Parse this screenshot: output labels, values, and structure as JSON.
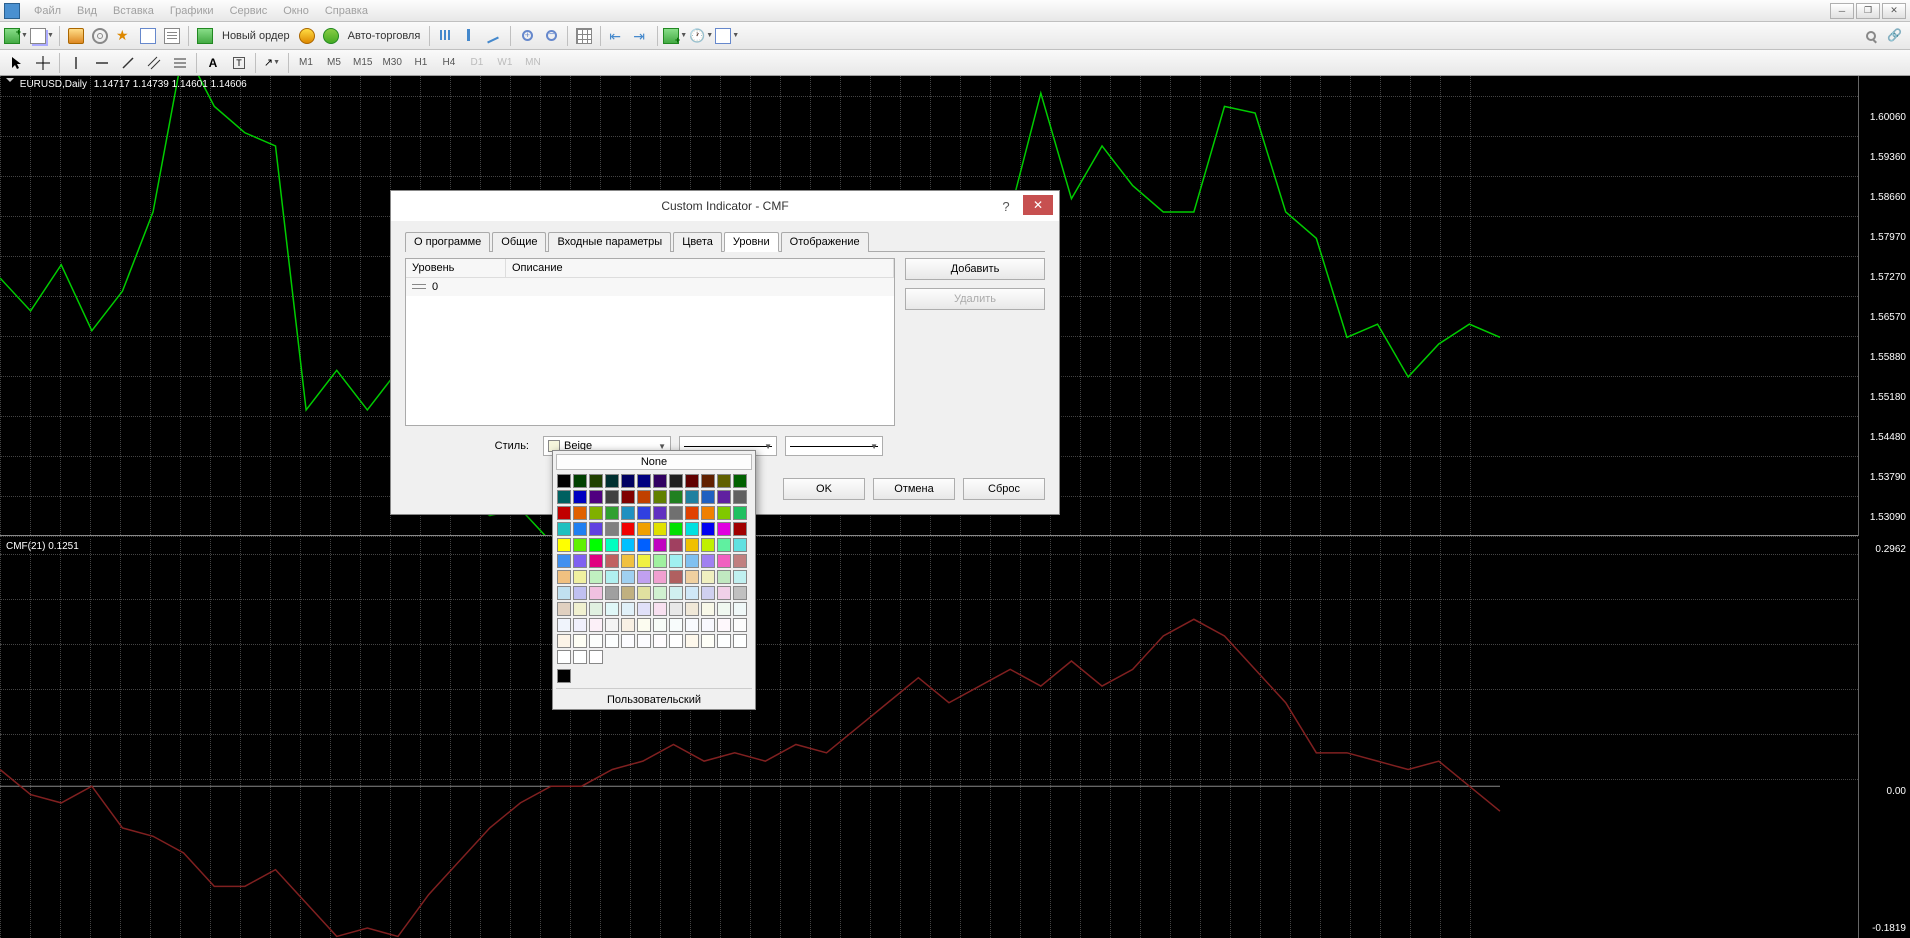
{
  "menu": {
    "items": [
      "Файл",
      "Вид",
      "Вставка",
      "Графики",
      "Сервис",
      "Окно",
      "Справка"
    ]
  },
  "toolbar1": {
    "new_order": "Новый ордер",
    "auto_trade": "Авто-торговля"
  },
  "timeframes": [
    "M1",
    "M5",
    "M15",
    "M30",
    "H1",
    "H4",
    "D1",
    "W1",
    "MN"
  ],
  "active_tf": "D1",
  "mainChart": {
    "label": "EURUSD,Daily",
    "ohlc": "1.14717 1.14739 1.14601 1.14606",
    "yticks": [
      "1.60060",
      "1.59360",
      "1.58660",
      "1.57970",
      "1.57270",
      "1.56570",
      "1.55880",
      "1.55180",
      "1.54480",
      "1.53790",
      "1.53090"
    ]
  },
  "subChart": {
    "label": "CMF(21) 0.1251",
    "yticks": [
      "0.2962",
      "0.00",
      "-0.1819"
    ]
  },
  "dialog": {
    "title": "Custom Indicator - CMF",
    "tabs": [
      "О программе",
      "Общие",
      "Входные параметры",
      "Цвета",
      "Уровни",
      "Отображение"
    ],
    "active_tab": "Уровни",
    "cols": {
      "level": "Уровень",
      "desc": "Описание"
    },
    "row_value": "0",
    "add": "Добавить",
    "del": "Удалить",
    "style_label": "Стиль:",
    "color_name": "Beige",
    "ok": "OK",
    "cancel": "Отмена",
    "reset": "Сброс"
  },
  "picker": {
    "none": "None",
    "custom": "Пользовательский",
    "colors": [
      "#000000",
      "#004000",
      "#204000",
      "#003030",
      "#000060",
      "#000080",
      "#300060",
      "#202020",
      "#600000",
      "#602000",
      "#606000",
      "#006000",
      "#006060",
      "#0000c0",
      "#500080",
      "#404040",
      "#800000",
      "#c04000",
      "#608000",
      "#208020",
      "#2080a0",
      "#2060c0",
      "#6020a0",
      "#606060",
      "#c00000",
      "#e06000",
      "#80b000",
      "#30a030",
      "#2090c0",
      "#3040e0",
      "#6030c0",
      "#707070",
      "#e04000",
      "#f08000",
      "#80c800",
      "#20c060",
      "#20c0c0",
      "#2080f0",
      "#6040e0",
      "#808080",
      "#f00000",
      "#f0a000",
      "#e0e000",
      "#00e000",
      "#00e0e0",
      "#0000f0",
      "#e000e0",
      "#a00000",
      "#ffff00",
      "#60f000",
      "#00ff00",
      "#00ffc0",
      "#00c0ff",
      "#0060ff",
      "#c000c0",
      "#a04060",
      "#f0c000",
      "#c0f000",
      "#60f0a0",
      "#60e0e0",
      "#4090f0",
      "#8060f0",
      "#e00080",
      "#c06060",
      "#f0c040",
      "#f0f040",
      "#a0f0a0",
      "#a0f0f0",
      "#80c0f0",
      "#a080f0",
      "#f060c0",
      "#c08080",
      "#f0c080",
      "#f0f0a0",
      "#c0f0c0",
      "#b0f0f0",
      "#a0d0f0",
      "#c0a0f0",
      "#f0a0d0",
      "#b06060",
      "#f0d0a0",
      "#f0f0c0",
      "#c0e8c0",
      "#c0f0f0",
      "#c0e0f0",
      "#c0c0f0",
      "#f0c0e0",
      "#a0a0a0",
      "#c0b080",
      "#e0e0a0",
      "#d0f0d0",
      "#d0f0f0",
      "#d0e8f8",
      "#d0d0f0",
      "#f0d0e8",
      "#c0c0c0",
      "#e0d0c0",
      "#f0f0d0",
      "#e0f0e0",
      "#e0f8f8",
      "#e0f0f8",
      "#e0e0f8",
      "#f8e0f0",
      "#e8e8e8",
      "#f0e8d8",
      "#f8f8e8",
      "#f0f8f0",
      "#f0f8f8",
      "#f0f4fc",
      "#f0f0fc",
      "#fcf0f8",
      "#f4f4f4",
      "#f8f0e4",
      "#fcfcf0",
      "#f8fcf8",
      "#f8fcfc",
      "#f8fafe",
      "#f8f8fe",
      "#fef8fc",
      "#fcfcfc",
      "#fcf4e8",
      "#fefef4",
      "#fcfefc",
      "#fcfefe",
      "#fcfcff",
      "#fcfcff",
      "#fffcfe",
      "#ffffff",
      "#fef8ec",
      "#fffff8",
      "#feffff",
      "#feffff",
      "#feffff",
      "#feffff",
      "#fffeff"
    ],
    "extra": "#000000"
  },
  "chart_data": {
    "type": "line",
    "main": {
      "series_name": "EURUSD",
      "x": [
        0,
        1,
        2,
        3,
        4,
        5,
        6,
        7,
        8,
        9,
        10,
        11,
        12,
        13,
        14,
        15,
        16,
        17,
        18,
        19,
        20,
        21,
        22,
        23,
        24,
        25,
        26,
        27,
        28,
        29,
        30,
        31,
        32,
        33,
        34,
        35,
        36,
        37,
        38,
        39,
        40,
        41,
        42,
        43,
        44,
        45,
        46,
        47,
        48,
        49
      ],
      "y": [
        1.57,
        1.565,
        1.572,
        1.562,
        1.568,
        1.58,
        1.605,
        1.596,
        1.592,
        1.59,
        1.55,
        1.556,
        1.55,
        1.556,
        1.54,
        1.537,
        1.534,
        1.535,
        1.53,
        1.54,
        1.56,
        1.554,
        1.548,
        1.548,
        1.552,
        1.565,
        1.565,
        1.565,
        1.564,
        1.566,
        1.557,
        1.568,
        1.568,
        1.58,
        1.598,
        1.582,
        1.59,
        1.584,
        1.58,
        1.58,
        1.596,
        1.595,
        1.58,
        1.576,
        1.561,
        1.563,
        1.555,
        1.56,
        1.563,
        1.561
      ],
      "ylim": [
        1.5309,
        1.6006
      ],
      "color": "#00cc00"
    },
    "sub": {
      "series_name": "CMF(21)",
      "x": [
        0,
        1,
        2,
        3,
        4,
        5,
        6,
        7,
        8,
        9,
        10,
        11,
        12,
        13,
        14,
        15,
        16,
        17,
        18,
        19,
        20,
        21,
        22,
        23,
        24,
        25,
        26,
        27,
        28,
        29,
        30,
        31,
        32,
        33,
        34,
        35,
        36,
        37,
        38,
        39,
        40,
        41,
        42,
        43,
        44,
        45,
        46,
        47,
        48,
        49
      ],
      "y": [
        0.02,
        -0.01,
        -0.02,
        0.0,
        -0.05,
        -0.06,
        -0.08,
        -0.12,
        -0.12,
        -0.1,
        -0.14,
        -0.18,
        -0.17,
        -0.18,
        -0.13,
        -0.09,
        -0.05,
        -0.02,
        0.0,
        0.0,
        0.02,
        0.03,
        0.05,
        0.03,
        0.04,
        0.03,
        0.05,
        0.04,
        0.07,
        0.1,
        0.13,
        0.1,
        0.12,
        0.14,
        0.12,
        0.15,
        0.12,
        0.14,
        0.18,
        0.2,
        0.18,
        0.14,
        0.1,
        0.04,
        0.04,
        0.03,
        0.02,
        0.03,
        0.0,
        -0.03
      ],
      "ylim": [
        -0.1819,
        0.2962
      ],
      "zero_line": 0.0,
      "color": "#802020"
    }
  }
}
